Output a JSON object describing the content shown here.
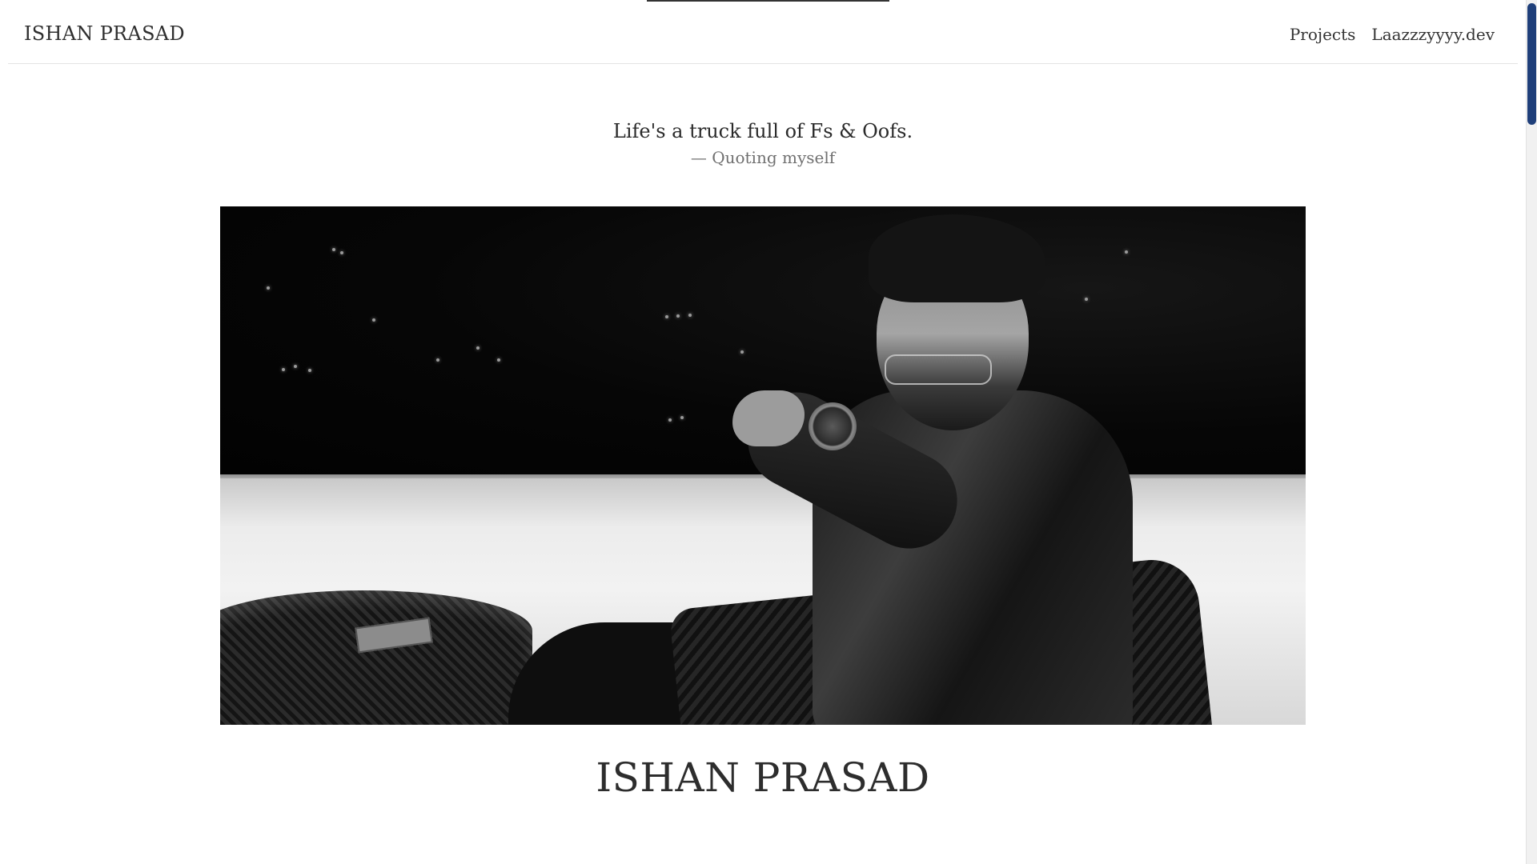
{
  "header": {
    "brand": "ISHAN PRASAD",
    "nav": [
      "Projects",
      "Laazzzyyyy.dev"
    ]
  },
  "quote": {
    "text": "Life's a truck full of Fs & Oofs.",
    "author": "— Quoting myself"
  },
  "hero": {
    "image_icon": "portrait-photo-icon"
  },
  "main": {
    "name": "ISHAN PRASAD"
  },
  "colors": {
    "scrollbar_thumb": "#1f3f7a",
    "text": "#2e2e2e",
    "muted": "#707070"
  }
}
